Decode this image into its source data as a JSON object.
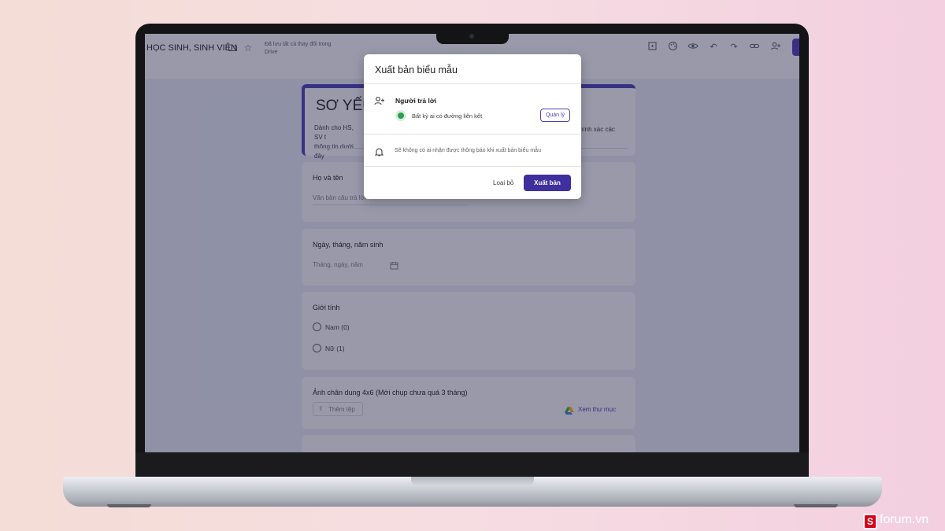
{
  "header": {
    "doc_title": "HỌC SINH, SINH VIÊN",
    "save_note": "Đã lưu tất cả thay đổi trong Drive"
  },
  "form": {
    "title": "SƠ YẾU",
    "desc_start": "Dành cho HS, SV t",
    "desc_start2": "thông tin dưới đây",
    "desc_end": "chính xác các",
    "questions": {
      "name": {
        "title": "Họ và tên",
        "placeholder": "Văn bản câu trả lời"
      },
      "dob": {
        "title": "Ngày, tháng, năm sinh",
        "placeholder": "Tháng, ngày, năm"
      },
      "gender": {
        "title": "Giới tính",
        "options": [
          "Nam (0)",
          "Nữ (1)"
        ]
      },
      "photo": {
        "title": "Ảnh chân dung 4x6 (Mới chụp chưa quá 3 tháng)",
        "add_file": "Thêm tệp",
        "view_folder": "Xem thư mục"
      }
    }
  },
  "dialog": {
    "title": "Xuất bản biểu mẫu",
    "responders_label": "Người trả lời",
    "link_access": "Bất kỳ ai có đường liên kết",
    "manage_label": "Quản lý",
    "notify_text": "Sẽ không có ai nhận được thông báo khi xuất bản biểu mẫu",
    "discard_label": "Loại bỏ",
    "publish_label": "Xuất bản"
  },
  "watermark": {
    "text": "forum.vn",
    "letter": "S"
  },
  "colors": {
    "accent": "#4b41b6",
    "publish": "#3f2f9f",
    "overlay": "rgba(32,33,70,0.46)"
  }
}
